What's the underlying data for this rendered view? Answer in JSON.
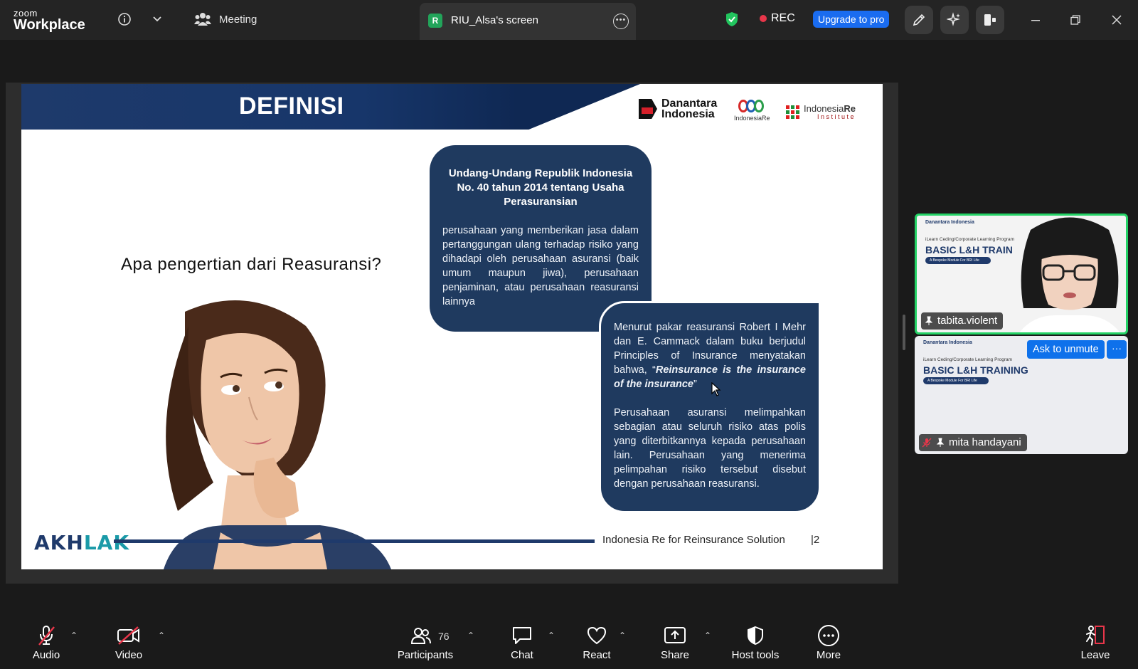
{
  "app": {
    "logo_small": "zoom",
    "logo_big": "Workplace",
    "meeting_label": "Meeting",
    "screen_tab_badge": "R",
    "screen_tab_label": "RIU_Alsa's screen",
    "rec_label": "REC",
    "upgrade_label": "Upgrade to pro"
  },
  "slide": {
    "title": "DEFINISI",
    "brand_danantara_line1": "Danantara",
    "brand_danantara_line2": "Indonesia",
    "brand_ire_label": "IndonesiaRe",
    "brand_inst_line1": "Indonesia",
    "brand_inst_line1_bold": "Re",
    "brand_inst_line2": "Institute",
    "question": "Apa pengertian dari Reasuransi?",
    "bubble1_head": "Undang-Undang Republik Indonesia No. 40 tahun 2014 tentang Usaha Perasuransian",
    "bubble1_body": "perusahaan yang memberikan jasa dalam pertanggungan ulang terhadap risiko yang dihadapi oleh perusahaan asuransi (baik umum maupun jiwa), perusahaan penjaminan, atau perusahaan reasuransi lainnya",
    "bubble2_p1_pre": "Menurut pakar reasuransi Robert I Mehr dan E. Cammack dalam buku berjudul Principles of Insurance menyatakan bahwa, “",
    "bubble2_p1_quote": "Reinsurance is the insurance of the insurance",
    "bubble2_p1_post": "”",
    "bubble2_p2": "Perusahaan asuransi melimpahkan sebagian atau seluruh risiko atas polis yang diterbitkannya kepada perusahaan lain. Perusahaan yang menerima pelimpahan risiko tersebut disebut dengan perusahaan reasuransi.",
    "footer_logo_a": "AKH",
    "footer_logo_b": "LAK",
    "footer_text": "Indonesia Re for Reinsurance Solution",
    "footer_page": "|2"
  },
  "participants": {
    "tile1": {
      "brand": "Danantara Indonesia",
      "sub": "iLearn Ceding/Corporate Learning Program",
      "title": "BASIC L&H TRAIN",
      "pill": "A Bespoke Module For BRI Life",
      "name": "tabita.violent"
    },
    "tile2": {
      "brand": "Danantara Indonesia",
      "sub": "iLearn Ceding/Corporate Learning Program",
      "title": "BASIC L&H TRAINING",
      "pill": "A Bespoke Module For BRI Life",
      "name": "mita handayani",
      "ask_unmute": "Ask to unmute",
      "more": "···"
    }
  },
  "toolbar": {
    "audio": "Audio",
    "video": "Video",
    "participants": "Participants",
    "participants_count": "76",
    "chat": "Chat",
    "react": "React",
    "share": "Share",
    "host_tools": "Host tools",
    "more": "More",
    "leave": "Leave"
  },
  "colors": {
    "accent_blue": "#0e71eb",
    "active_speaker": "#24d366",
    "rec_dot": "#e8364a",
    "slide_navy": "#1f3a5f",
    "shield_green": "#22c55e"
  }
}
